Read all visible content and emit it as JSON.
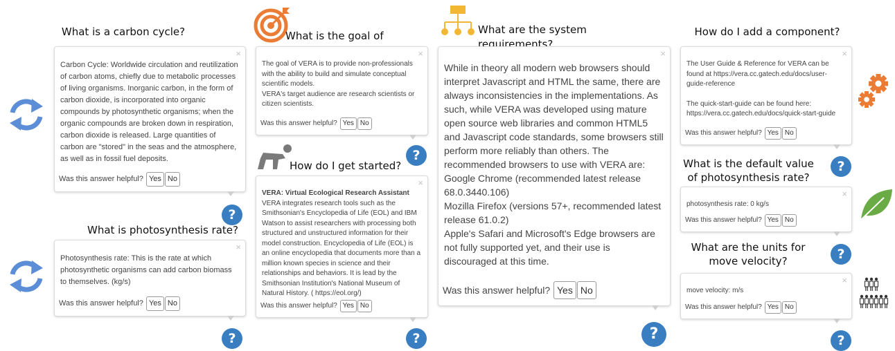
{
  "colors": {
    "help_blue": "#3a7ec2",
    "refresh_blue": "#5b8ed6",
    "orange": "#ea7c35",
    "leaf_green": "#6aab45",
    "figure_gray": "#7a7a7a"
  },
  "icons": [
    "refresh-icon",
    "target-icon",
    "hierarchy-icon",
    "crawl-figure-icon",
    "gears-icon",
    "leaf-icon",
    "people-icon",
    "help-icon",
    "close-icon"
  ],
  "help_label": "?",
  "close_label": "×",
  "helpful": {
    "prompt": "Was this answer helpful?",
    "yes": "Yes",
    "no": "No"
  },
  "carbon_cycle": {
    "question": "What is a carbon cycle?",
    "answer": "Carbon Cycle: Worldwide circulation and reutilization of carbon atoms, chiefly due to metabolic processes of living organisms. Inorganic carbon, in the form of carbon dioxide, is incorporated into organic compounds by photosynthetic organisms; when the organic compounds are broken down in respiration, carbon dioxide is released. Large quantities of carbon are \"stored\" in the seas and the atmosphere, as well as in fossil fuel deposits."
  },
  "photosynthesis_rate": {
    "question": "What is photosynthesis rate?",
    "answer": "Photosynthesis rate: This is the rate at which photosynthetic organisms can add carbon biomass to themselves. (kg/s)"
  },
  "goal": {
    "question": "What is the goal of VERA?",
    "answer": [
      "The goal of VERA is to provide non-professionals with the ability to build and simulate conceptual scientific models.",
      "VERA's target audience are research scientists or citizen scientists."
    ]
  },
  "get_started": {
    "question": "How do I get started?",
    "answer_bold": "VERA: Virtual Ecological Research Assistant",
    "answer_rest": " VERA integrates research tools such as the Smithsonian's Encyclopedia of Life (EOL) and IBM Watson to assist researchers with processing both structured and unstructured information for their model construction. Encyclopedia of Life (EOL) is an online encyclopedia that documents more than a million known species in science and their relationships and behaviors. It is lead by the Smithsonian Institution's National Museum of Natural History. ( https://eol.org/)"
  },
  "system_requirements": {
    "question": "What are the system requirements?",
    "answer": [
      "While in theory all modern web browsers should interpret Javascript and HTML the same, there are always inconsistencies in the implementations. As such, while VERA was developed using mature open source web libraries and common HTML5 and Javascript code standards, some browsers still perform more reliably than others. The recommended browsers to use with VERA are:",
      "Google Chrome (recommended latest release 68.0.3440.106)",
      "Mozilla Firefox (versions 57+, recommended latest release 61.0.2)",
      "Apple's Safari and Microsoft's Edge browsers are not fully supported yet, and their use is discouraged at this time."
    ]
  },
  "add_component": {
    "question": "How do I add a component?",
    "answer": [
      "The User Guide & Reference for VERA can be found at https://vera.cc.gatech.edu/docs/user-guide-reference",
      "The quick-start-guide can be found here: https://vera.cc.gatech.edu/docs/quick-start-guide"
    ]
  },
  "default_value": {
    "question": "What is the default value of photosynthesis rate?",
    "answer": "photosynthesis rate: 0 kg/s"
  },
  "units": {
    "question": "What are the units for move velocity?",
    "answer": "move velocity: m/s"
  }
}
